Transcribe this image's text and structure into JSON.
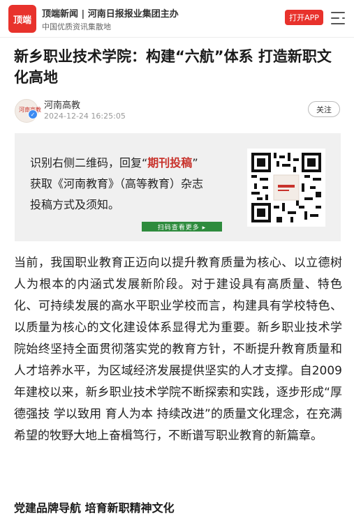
{
  "header": {
    "logo_text": "顶端",
    "brand_title": "顶端新闻 | 河南日报报业集团主办",
    "brand_subtitle": "中国优质资讯集散地",
    "open_app_label": "打开APP"
  },
  "article": {
    "title": "新乡职业技术学院：构建“六航”体系 打造新职文化高地",
    "author": "河南高教",
    "avatar_seal": "河南高教",
    "published": "2024-12-24 16:25:05",
    "follow_label": "关注"
  },
  "banner": {
    "line1_pre": "识别右侧二维码，回复“",
    "line1_highlight": "期刊投稿",
    "line1_post": "”",
    "line2": "获取《河南教育》（高等教育）杂志",
    "line3": "投稿方式及须知。",
    "scan_label": "扫码查看更多 ▸"
  },
  "body": {
    "paragraph1": "当前，我国职业教育正迈向以提升教育质量为核心、以立德树人为根本的内涵式发展新阶段。对于建设具有高质量、特色化、可持续发展的高水平职业学校而言，构建具有学校特色、以质量为核心的文化建设体系显得尤为重要。新乡职业技术学院始终坚持全面贯彻落实党的教育方针，不断提升教育质量和人才培养水平，为区域经济发展提供坚实的人才支撑。自2009年建校以来，新乡职业技术学院不断探索和实践，逐步形成“厚德强技 学以致用 育人为本 持续改进”的质量文化理念，在充满希望的牧野大地上奋楫笃行，不断谱写职业教育的新篇章。",
    "section1_heading": "党建品牌导航 培育新职精神文化"
  },
  "colors": {
    "brand_red": "#e8322c",
    "highlight_red": "#c8322b",
    "scan_green": "#2e8b3d"
  },
  "icons": {
    "menu": "menu-icon",
    "verified": "verified-badge-icon",
    "qr": "qr-code-image"
  }
}
